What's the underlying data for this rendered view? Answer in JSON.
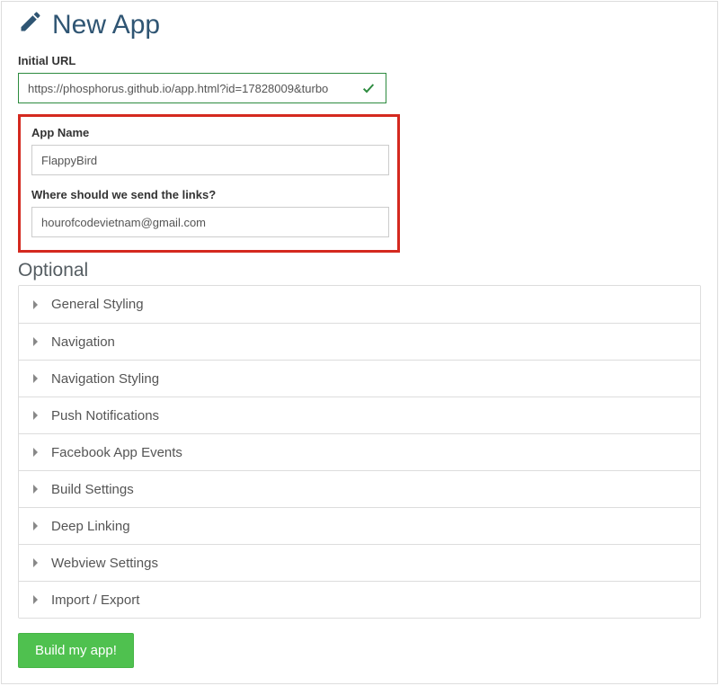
{
  "header": {
    "title": "New App"
  },
  "form": {
    "initial_url": {
      "label": "Initial URL",
      "value": "https://phosphorus.github.io/app.html?id=17828009&turbo"
    },
    "app_name": {
      "label": "App Name",
      "value": "FlappyBird"
    },
    "email": {
      "label": "Where should we send the links?",
      "value": "hourofcodevietnam@gmail.com"
    }
  },
  "optional": {
    "heading": "Optional",
    "items": [
      "General Styling",
      "Navigation",
      "Navigation Styling",
      "Push Notifications",
      "Facebook App Events",
      "Build Settings",
      "Deep Linking",
      "Webview Settings",
      "Import / Export"
    ]
  },
  "actions": {
    "build_label": "Build my app!"
  }
}
